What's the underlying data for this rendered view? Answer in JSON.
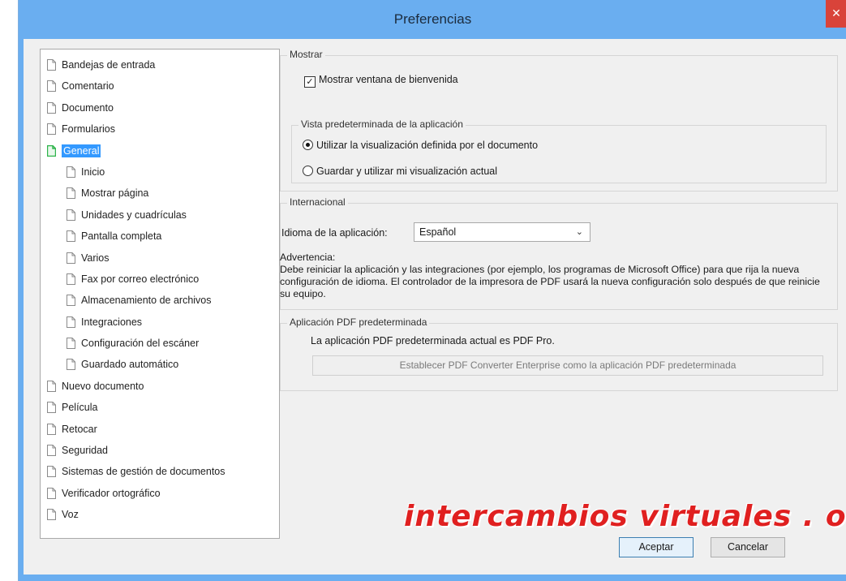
{
  "window": {
    "title": "Preferencias",
    "close_glyph": "✕"
  },
  "tree": {
    "items": [
      {
        "label": "Bandejas de entrada",
        "level": 0
      },
      {
        "label": "Comentario",
        "level": 0
      },
      {
        "label": "Documento",
        "level": 0
      },
      {
        "label": "Formularios",
        "level": 0
      },
      {
        "label": "General",
        "level": 0,
        "selected": true
      },
      {
        "label": "Inicio",
        "level": 1
      },
      {
        "label": "Mostrar página",
        "level": 1
      },
      {
        "label": "Unidades y cuadrículas",
        "level": 1
      },
      {
        "label": "Pantalla completa",
        "level": 1
      },
      {
        "label": "Varios",
        "level": 1
      },
      {
        "label": "Fax por correo electrónico",
        "level": 1
      },
      {
        "label": "Almacenamiento de archivos",
        "level": 1
      },
      {
        "label": "Integraciones",
        "level": 1
      },
      {
        "label": "Configuración del escáner",
        "level": 1
      },
      {
        "label": "Guardado automático",
        "level": 1
      },
      {
        "label": "Nuevo documento",
        "level": 0
      },
      {
        "label": "Película",
        "level": 0
      },
      {
        "label": "Retocar",
        "level": 0
      },
      {
        "label": "Seguridad",
        "level": 0
      },
      {
        "label": "Sistemas de gestión de documentos",
        "level": 0
      },
      {
        "label": "Verificador ortográfico",
        "level": 0
      },
      {
        "label": "Voz",
        "level": 0
      }
    ]
  },
  "mostrar": {
    "title": "Mostrar",
    "welcome_checkbox": {
      "label": "Mostrar ventana de bienvenida",
      "checked": true
    },
    "vista": {
      "title": "Vista predeterminada de la aplicación",
      "option1": {
        "label": "Utilizar la visualización definida por el documento",
        "selected": true
      },
      "option2": {
        "label": "Guardar y utilizar mi visualización actual",
        "selected": false
      }
    }
  },
  "internacional": {
    "title": "Internacional",
    "language_label": "Idioma de la aplicación:",
    "language_value": "Español",
    "warning_title": "Advertencia:",
    "warning_text": "Debe reiniciar la aplicación y las integraciones (por ejemplo, los programas de Microsoft Office) para que rija la nueva configuración de idioma. El controlador de la impresora de PDF usará la nueva configuración solo después de que reinicie su equipo."
  },
  "pdf_default": {
    "title": "Aplicación PDF predeterminada",
    "status": "La aplicación PDF predeterminada actual es PDF Pro.",
    "set_button": "Establecer PDF Converter Enterprise como la aplicación PDF predeterminada"
  },
  "footer": {
    "ok_label": "Aceptar",
    "cancel_label": "Cancelar"
  },
  "watermark": "intercambios virtuales . org",
  "colors": {
    "titlebar": "#6aaef0",
    "selection": "#3399ff",
    "close": "#d9433a",
    "selected_icon": "#2db34a",
    "watermark": "#e02020"
  }
}
